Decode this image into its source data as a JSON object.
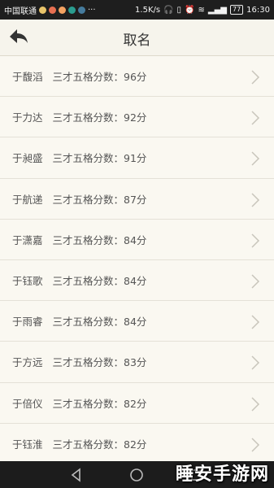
{
  "status_bar": {
    "carrier": "中国联通",
    "network_speed": "1.5K/s",
    "battery": "77",
    "time": "16:30",
    "more": "···"
  },
  "header": {
    "title": "取名"
  },
  "list": {
    "score_prefix": "三才五格分数：",
    "items": [
      {
        "name": "于馥滔",
        "score": "96分"
      },
      {
        "name": "于力达",
        "score": "92分"
      },
      {
        "name": "于昶盛",
        "score": "91分"
      },
      {
        "name": "于航递",
        "score": "87分"
      },
      {
        "name": "于潇嘉",
        "score": "84分"
      },
      {
        "name": "于钰歌",
        "score": "84分"
      },
      {
        "name": "于雨睿",
        "score": "84分"
      },
      {
        "name": "于方远",
        "score": "83分"
      },
      {
        "name": "于倍仪",
        "score": "82分"
      },
      {
        "name": "于钰淮",
        "score": "82分"
      }
    ]
  },
  "watermark": "睡安手游网"
}
